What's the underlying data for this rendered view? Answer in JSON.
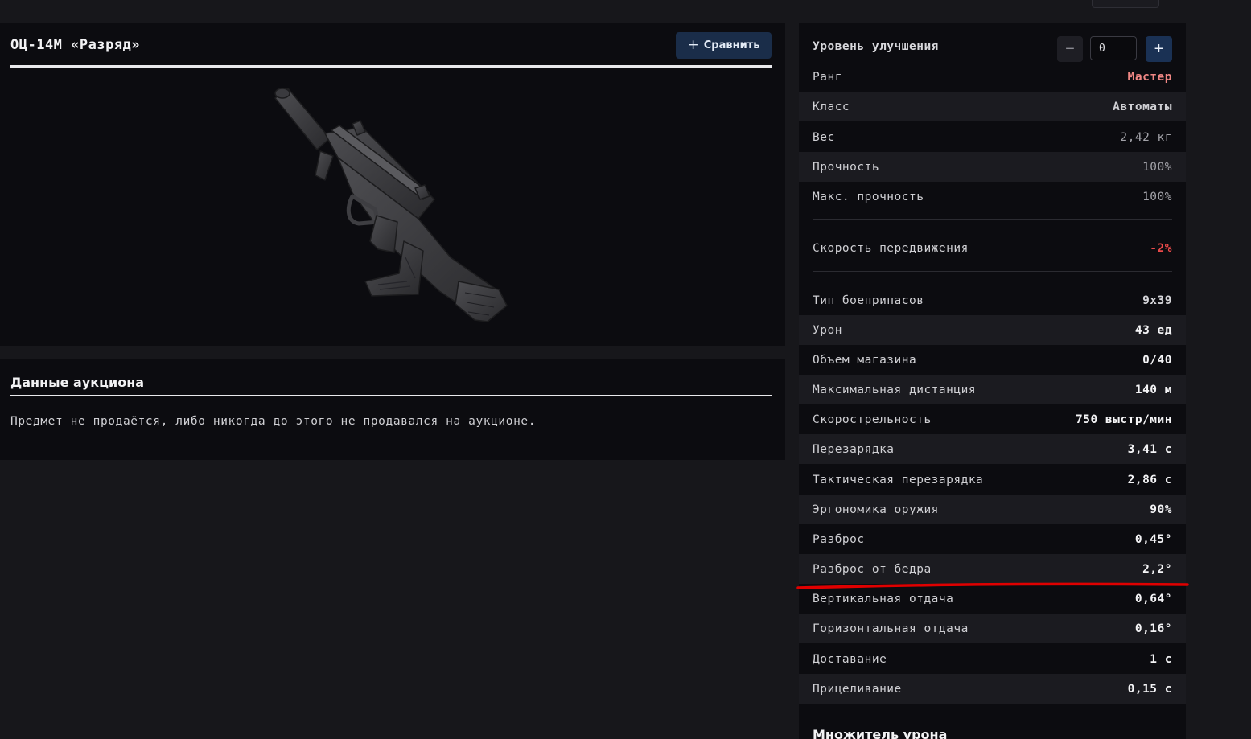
{
  "item": {
    "title": "ОЦ-14М «Разряд»",
    "compare_label": "Сравнить"
  },
  "auction": {
    "title": "Данные аукциона",
    "message": "Предмет не продаётся, либо никогда до этого не продавался на аукционе."
  },
  "stats": {
    "upgrade_label": "Уровень улучшения",
    "upgrade_value": "0",
    "rows": [
      {
        "label": "Ранг",
        "value": "Мастер"
      },
      {
        "label": "Класс",
        "value": "Автоматы"
      },
      {
        "label": "Вес",
        "value": "2,42 кг"
      },
      {
        "label": "Прочность",
        "value": "100%"
      },
      {
        "label": "Макс. прочность",
        "value": "100%"
      },
      {
        "label": "Скорость передвижения",
        "value": "-2%"
      },
      {
        "label": "Тип боеприпасов",
        "value": "9x39"
      },
      {
        "label": "Урон",
        "value": "43 ед"
      },
      {
        "label": "Объем магазина",
        "value": "0/40"
      },
      {
        "label": "Максимальная дистанция",
        "value": "140 м"
      },
      {
        "label": "Скорострельность",
        "value": "750 выстр/мин"
      },
      {
        "label": "Перезарядка",
        "value": "3,41 с"
      },
      {
        "label": "Тактическая перезарядка",
        "value": "2,86 с"
      },
      {
        "label": "Эргономика оружия",
        "value": "90%"
      },
      {
        "label": "Разброс",
        "value": "0,45°"
      },
      {
        "label": "Разброс от бедра",
        "value": "2,2°"
      },
      {
        "label": "Вертикальная отдача",
        "value": "0,64°"
      },
      {
        "label": "Горизонтальная отдача",
        "value": "0,16°"
      },
      {
        "label": "Доставание",
        "value": "1 с"
      },
      {
        "label": "Прицеливание",
        "value": "0,15 с"
      }
    ],
    "next_section_title": "Множитель урона"
  },
  "colors": {
    "rank": "#f08784",
    "negative": "#ec4a4a",
    "accent_button": "#1a3154",
    "highlight": "#e00000"
  },
  "icons": {
    "compare": "plus-icon",
    "decrement": "minus-icon",
    "increment": "plus-icon"
  }
}
